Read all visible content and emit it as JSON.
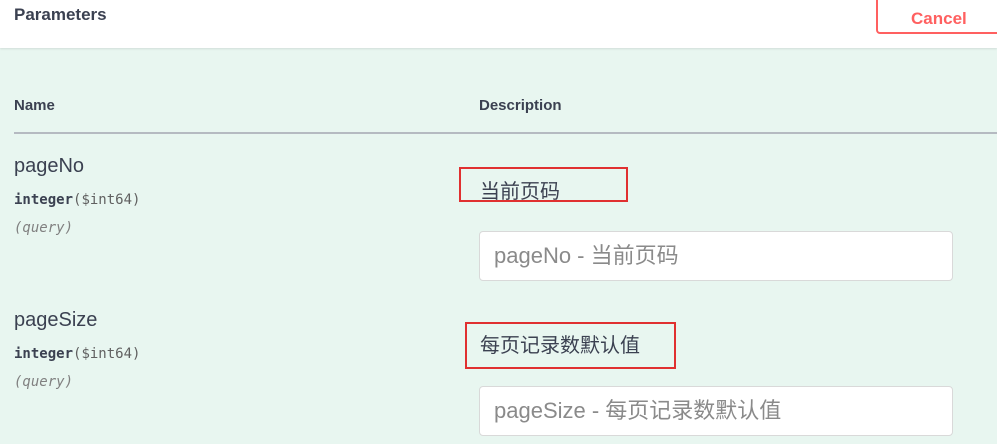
{
  "header": {
    "title": "Parameters",
    "cancel_label": "Cancel"
  },
  "table": {
    "col_name": "Name",
    "col_description": "Description"
  },
  "parameters": [
    {
      "name": "pageNo",
      "type": "integer",
      "format": "($int64)",
      "in": "(query)",
      "description": "当前页码",
      "placeholder": "pageNo - 当前页码",
      "value": ""
    },
    {
      "name": "pageSize",
      "type": "integer",
      "format": "($int64)",
      "in": "(query)",
      "description": "每页记录数默认值",
      "placeholder": "pageSize - 每页记录数默认值",
      "value": ""
    }
  ],
  "colors": {
    "header_bg": "#ffffff",
    "body_bg": "#e8f6f0",
    "cancel_accent": "#ff6060",
    "highlight_box": "#e03030",
    "text": "#3b4151"
  }
}
